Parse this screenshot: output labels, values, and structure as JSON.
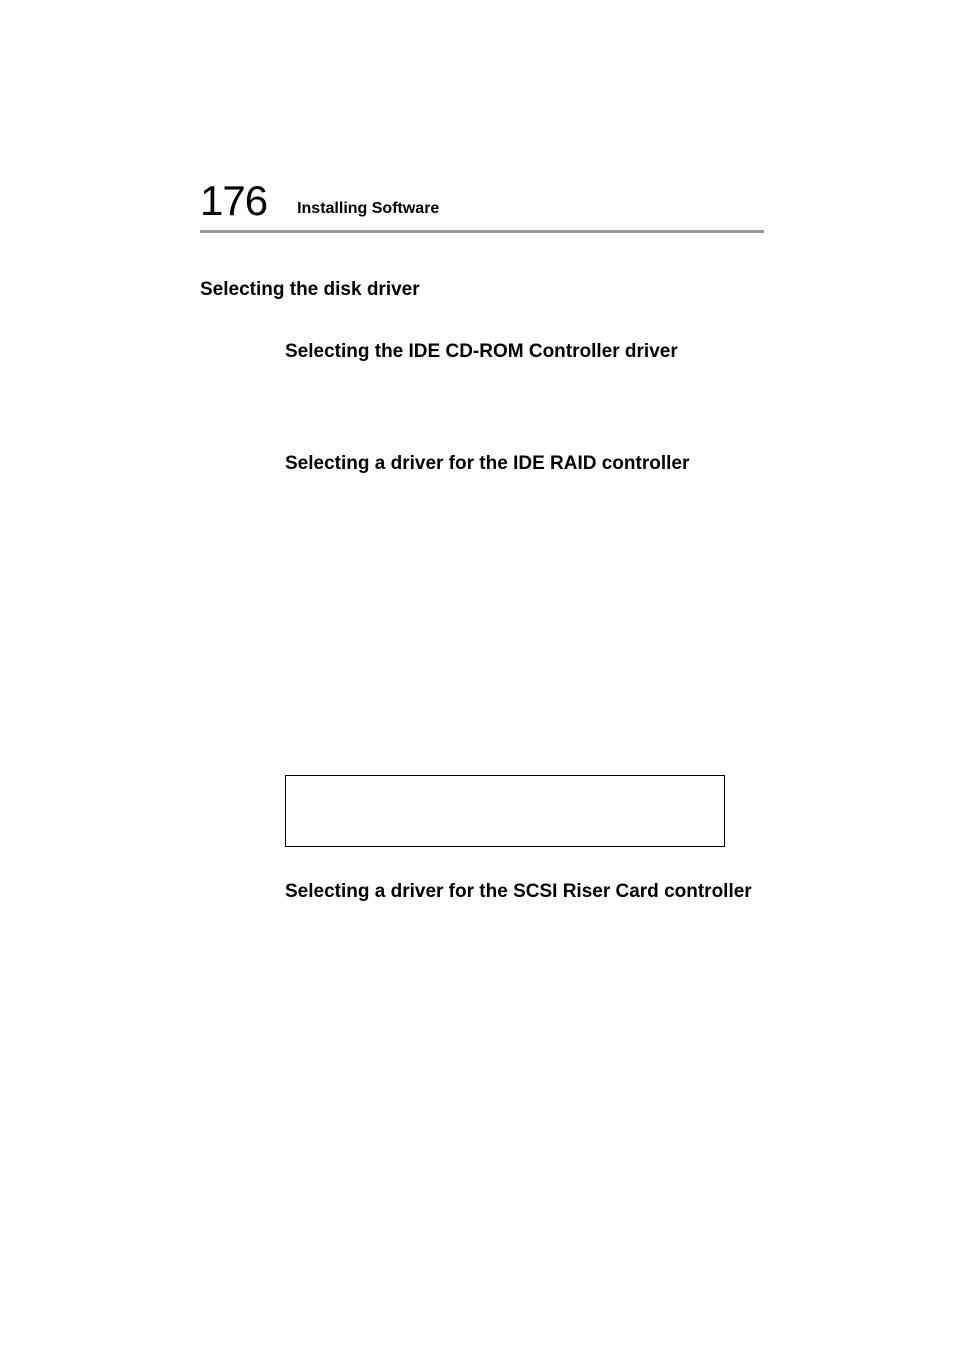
{
  "header": {
    "page_number": "176",
    "running_header": "Installing Software"
  },
  "section": {
    "title": "Selecting the disk driver"
  },
  "subsections": {
    "cdrom": "Selecting the IDE CD-ROM Controller driver",
    "ide_raid": "Selecting a driver for the IDE RAID controller",
    "scsi_riser": "Selecting a driver for the SCSI Riser Card controller"
  }
}
